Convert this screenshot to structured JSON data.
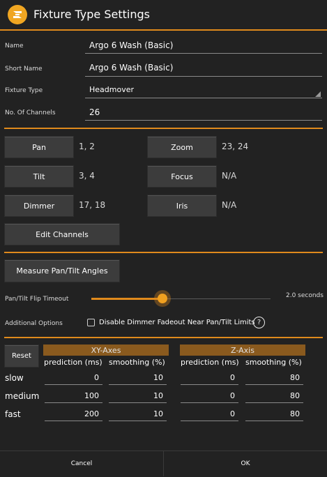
{
  "window": {
    "title": "Fixture Type Settings"
  },
  "fields": {
    "name": {
      "label": "Name",
      "value": "Argo 6 Wash (Basic)"
    },
    "short_name": {
      "label": "Short Name",
      "value": "Argo 6 Wash (Basic)"
    },
    "fixture_type": {
      "label": "Fixture Type",
      "value": "Headmover"
    },
    "channels": {
      "label": "No. Of Channels",
      "value": "26"
    }
  },
  "channel_map": [
    {
      "label": "Pan",
      "value": "1, 2"
    },
    {
      "label": "Zoom",
      "value": "23, 24"
    },
    {
      "label": "Tilt",
      "value": "3, 4"
    },
    {
      "label": "Focus",
      "value": "N/A"
    },
    {
      "label": "Dimmer",
      "value": "17, 18"
    },
    {
      "label": "Iris",
      "value": "N/A"
    }
  ],
  "edit_channels_label": "Edit Channels",
  "measure_label": "Measure Pan/Tilt Angles",
  "flip_timeout": {
    "label": "Pan/Tilt Flip Timeout",
    "value_text": "2.0 seconds",
    "level": 0.4
  },
  "additional": {
    "label": "Additional Options",
    "checkbox_label": "Disable Dimmer Fadeout Near Pan/Tilt Limits",
    "checked": false,
    "help": "?"
  },
  "smoothing": {
    "reset_label": "Reset",
    "xy_header": "XY-Axes",
    "z_header": "Z-Axis",
    "col_prediction": "prediction (ms)",
    "col_smoothing": "smoothing (%)",
    "rows": [
      {
        "label": "slow",
        "xy_prediction": "0",
        "xy_smoothing": "10",
        "z_prediction": "0",
        "z_smoothing": "80"
      },
      {
        "label": "medium",
        "xy_prediction": "100",
        "xy_smoothing": "10",
        "z_prediction": "0",
        "z_smoothing": "80"
      },
      {
        "label": "fast",
        "xy_prediction": "200",
        "xy_smoothing": "10",
        "z_prediction": "0",
        "z_smoothing": "80"
      }
    ]
  },
  "footer": {
    "cancel": "Cancel",
    "ok": "OK"
  },
  "colors": {
    "accent": "#e08a1c",
    "background": "#222222",
    "button": "#3c3c3c",
    "axis_header": "#8a5a1e"
  }
}
